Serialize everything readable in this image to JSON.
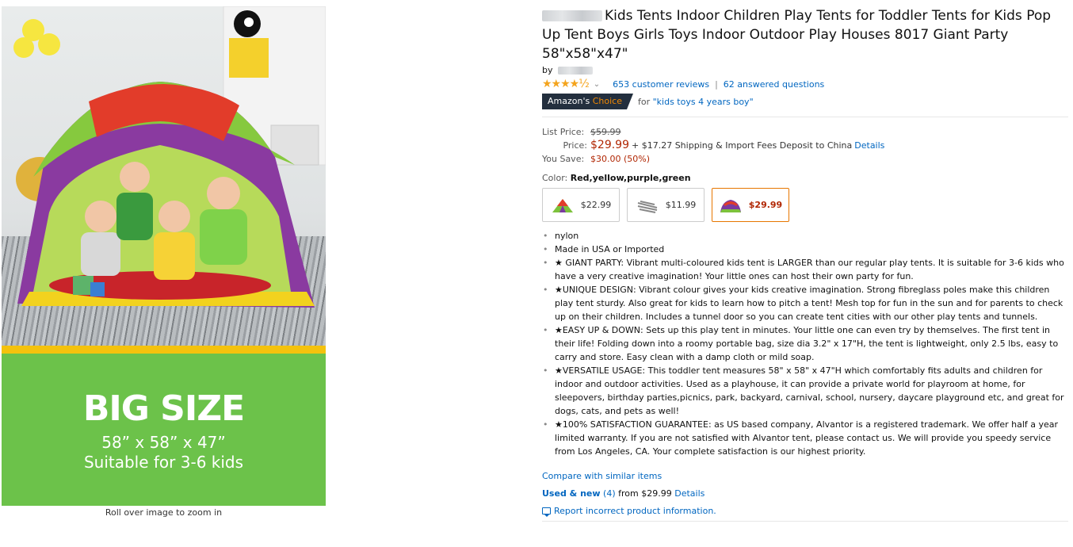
{
  "image": {
    "big_size": "BIG SIZE",
    "dims": "58” x 58” x 47”",
    "suitable": "Suitable for 3-6 kids",
    "zoom_hint": "Roll over image to zoom in"
  },
  "product": {
    "title": "Kids Tents Indoor Children Play Tents for Toddler Tents for Kids Pop Up Tent Boys Girls Toys Indoor Outdoor Play Houses 8017 Giant Party 58\"x58\"x47\"",
    "by_label": "by",
    "reviews": "653 customer reviews",
    "separator": "|",
    "questions": "62 answered questions",
    "stars": "★★★★½",
    "badge_prefix": "Amazon's",
    "badge_suffix": "Choice",
    "choice_for": "for",
    "choice_query": "\"kids toys 4 years boy\""
  },
  "pricing": {
    "list_label": "List Price:",
    "list_value": "$59.99",
    "price_label": "Price:",
    "price_value": "$29.99",
    "shipping": "+ $17.27 Shipping & Import Fees Deposit to China",
    "details_link": "Details",
    "save_label": "You Save:",
    "save_value": "$30.00 (50%)"
  },
  "color": {
    "label": "Color:",
    "value": "Red,yellow,purple,green",
    "options": [
      {
        "price": "$22.99",
        "selected": false
      },
      {
        "price": "$11.99",
        "selected": false
      },
      {
        "price": "$29.99",
        "selected": true
      }
    ]
  },
  "bullets": [
    "nylon",
    "Made in USA or Imported",
    "★ GIANT PARTY: Vibrant multi-coloured kids tent is LARGER than our regular play tents. It is suitable for 3-6 kids who have a very creative imagination! Your little ones can host their own party for fun.",
    "★UNIQUE DESIGN: Vibrant colour gives your kids creative imagination. Strong fibreglass poles make this children play tent sturdy. Also great for kids to learn how to pitch a tent! Mesh top for fun in the sun and for parents to check up on their children. Includes a tunnel door so you can create tent cities with our other play tents and tunnels.",
    "★EASY UP & DOWN: Sets up this play tent in minutes. Your little one can even try by themselves. The first tent in their life! Folding down into a roomy portable bag, size dia 3.2\" x 17\"H, the tent is lightweight, only 2.5 lbs, easy to carry and store. Easy clean with a damp cloth or mild soap.",
    "★VERSATILE USAGE: This toddler tent measures 58\" x 58\" x 47\"H which comfortably fits adults and children for indoor and outdoor activities. Used as a playhouse, it can provide a private world for playroom at home, for sleepovers, birthday parties,picnics, park, backyard, carnival, school, nursery, daycare playground etc, and great for dogs, cats, and pets as well!",
    "★100% SATISFACTION GUARANTEE: as US based company, Alvantor is a registered trademark. We offer half a year limited warranty. If you are not satisfied with Alvantor tent, please contact us. We will provide you speedy service from Los Angeles, CA. Your complete satisfaction is our highest priority."
  ],
  "links": {
    "compare": "Compare with similar items",
    "used_new": "Used & new",
    "used_count": "(4)",
    "used_from": "from $29.99",
    "used_details": "Details",
    "report": "Report incorrect product information."
  },
  "colors": {
    "link": "#0066c0",
    "price_red": "#b12704",
    "badge_bg": "#232f3e",
    "badge_orange": "#f08804",
    "star": "#f4a41d",
    "panel_green": "#6cc24a"
  }
}
